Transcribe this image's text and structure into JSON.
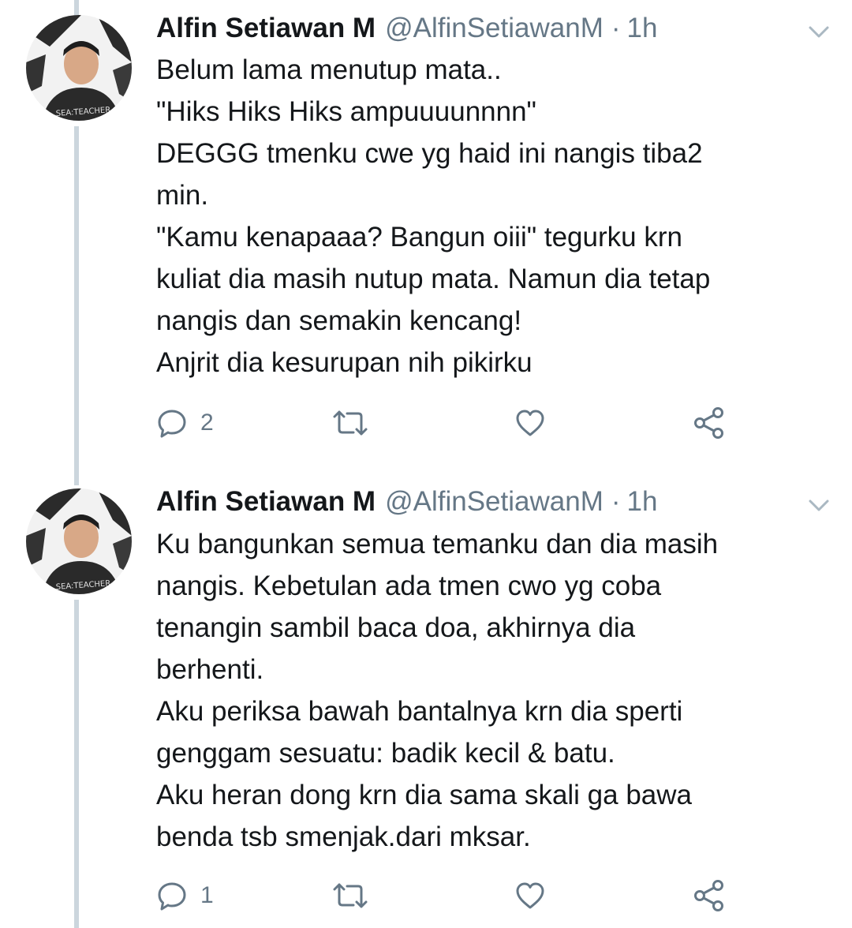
{
  "tweets": [
    {
      "author": {
        "display_name": "Alfin Setiawan M",
        "handle": "@AlfinSetiawanM",
        "shirt_text": "SEA:TEACHER"
      },
      "separator": "·",
      "time": "1h",
      "lines": [
        "Belum lama menutup mata..",
        "\"Hiks Hiks Hiks ampuuuunnnn\"",
        "DEGGG tmenku cwe yg haid ini nangis tiba2",
        "min.",
        "\"Kamu kenapaaa? Bangun oiii\" tegurku krn",
        "kuliat dia masih nutup mata. Namun dia tetap",
        "nangis dan semakin kencang!",
        "Anjrit dia kesurupan nih pikirku"
      ],
      "actions": {
        "reply_count": "2",
        "retweet_icon": "retweet-icon",
        "like_icon": "heart-icon",
        "share_icon": "share-icon"
      }
    },
    {
      "author": {
        "display_name": "Alfin Setiawan M",
        "handle": "@AlfinSetiawanM",
        "shirt_text": "SEA:TEACHER"
      },
      "separator": "·",
      "time": "1h",
      "lines": [
        "Ku bangunkan semua temanku dan dia masih",
        "nangis. Kebetulan ada tmen cwo yg coba",
        "tenangin sambil baca doa, akhirnya dia",
        "berhenti.",
        "Aku periksa bawah bantalnya krn dia sperti",
        "genggam sesuatu: badik kecil & batu.",
        "Aku heran dong krn dia sama skali ga bawa",
        "benda tsb smenjak.dari mksar."
      ],
      "actions": {
        "reply_count": "1",
        "retweet_icon": "retweet-icon",
        "like_icon": "heart-icon",
        "share_icon": "share-icon"
      }
    }
  ],
  "colors": {
    "text": "#14171a",
    "secondary": "#657786",
    "thread_line": "#ccd6dd"
  }
}
